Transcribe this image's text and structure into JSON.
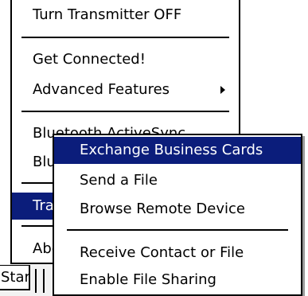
{
  "main_menu": {
    "items": [
      {
        "label": "Turn Transmitter OFF"
      },
      {
        "label": "Get Connected!"
      },
      {
        "label": "Advanced Features"
      },
      {
        "label": "Bluetooth ActiveSync"
      },
      {
        "label": "Blu"
      },
      {
        "label": "Tra"
      },
      {
        "label": "Abo"
      }
    ]
  },
  "sub_menu": {
    "items": [
      {
        "label": "Exchange Business Cards"
      },
      {
        "label": "Send a File"
      },
      {
        "label": "Browse Remote Device"
      },
      {
        "label": "Receive Contact or File"
      },
      {
        "label": "Enable File Sharing"
      }
    ]
  },
  "taskbar": {
    "start_label": "Start"
  },
  "colors": {
    "highlight": "#0b1d7b",
    "highlight_text": "#ffffff",
    "menu_background": "#ffffff",
    "border": "#000000"
  }
}
